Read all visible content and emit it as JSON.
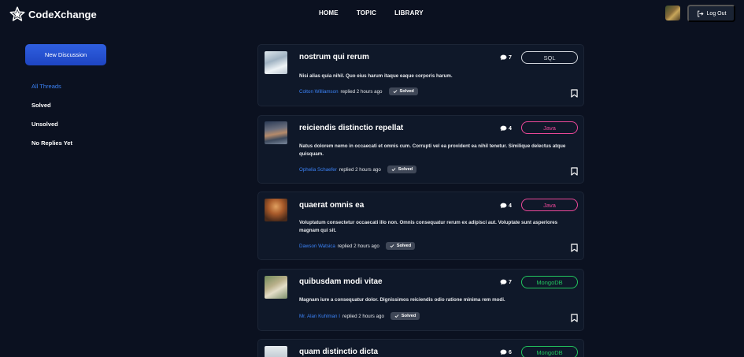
{
  "app": {
    "name": "CodeXchange",
    "logo_icon": "star-icon"
  },
  "nav": {
    "items": [
      "HOME",
      "TOPIC",
      "LIBRARY"
    ]
  },
  "user": {
    "logout_label": "Log Out",
    "logout_icon": "logout-icon"
  },
  "sidebar": {
    "new_button": "New Discussion",
    "filters": [
      {
        "label": "All Threads",
        "active": true
      },
      {
        "label": "Solved",
        "active": false
      },
      {
        "label": "Unsolved",
        "active": false
      },
      {
        "label": "No Replies Yet",
        "active": false
      }
    ]
  },
  "colors": {
    "accent": "#3b82f6",
    "sql": "#d1d5db",
    "java": "#ec4899",
    "mongodb": "#22c55e"
  },
  "threads": [
    {
      "title": "nostrum qui rerum",
      "comments": "7",
      "tag": "SQL",
      "description": "Nisi alias quia nihil. Quo eius harum itaque eaque corporis harum.",
      "author": "Colton Williamson",
      "replied": "replied 2 hours ago",
      "status": "Solved"
    },
    {
      "title": "reiciendis distinctio repellat",
      "comments": "4",
      "tag": "Java",
      "description": "Natus dolorem nemo in occaecati et omnis cum. Corrupti vel ea provident ea nihil tenetur. Similique delectus atque quisquam.",
      "author": "Ophelia Schaefer",
      "replied": "replied 2 hours ago",
      "status": "Solved"
    },
    {
      "title": "quaerat omnis ea",
      "comments": "4",
      "tag": "Java",
      "description": "Voluptatum consectetur occaecati illo non. Omnis consequatur rerum ex adipisci aut. Voluptate sunt asperiores magnam qui sit.",
      "author": "Dawson Watsica",
      "replied": "replied 2 hours ago",
      "status": "Solved"
    },
    {
      "title": "quibusdam modi vitae",
      "comments": "7",
      "tag": "MongoDB",
      "description": "Magnam iure a consequatur dolor. Dignissimos reiciendis odio ratione minima rem modi.",
      "author": "Mr. Alan Kuhlman I",
      "replied": "replied 2 hours ago",
      "status": "Solved"
    },
    {
      "title": "quam distinctio dicta",
      "comments": "6",
      "tag": "MongoDB"
    }
  ]
}
